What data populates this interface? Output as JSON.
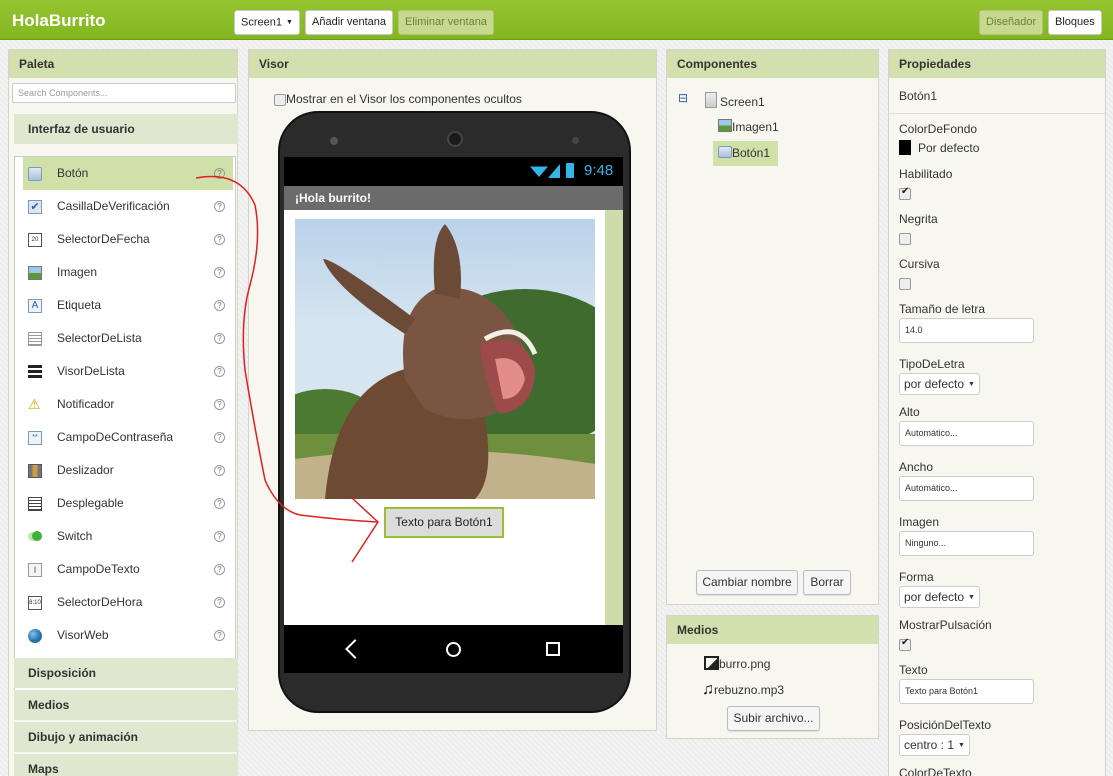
{
  "app": {
    "title": "HolaBurrito"
  },
  "toolbar": {
    "screen_select": "Screen1",
    "add_screen": "Añadir ventana",
    "remove_screen": "Eliminar ventana",
    "designer": "Diseñador",
    "blocks": "Bloques"
  },
  "palette": {
    "title": "Paleta",
    "search_placeholder": "Search Components...",
    "ui_section": "Interfaz de usuario",
    "items": [
      {
        "label": "Botón",
        "icon": "button-icon"
      },
      {
        "label": "CasillaDeVerificación",
        "icon": "checkbox-icon"
      },
      {
        "label": "SelectorDeFecha",
        "icon": "calendar-icon"
      },
      {
        "label": "Imagen",
        "icon": "image-icon"
      },
      {
        "label": "Etiqueta",
        "icon": "label-icon"
      },
      {
        "label": "SelectorDeLista",
        "icon": "listpicker-icon"
      },
      {
        "label": "VisorDeLista",
        "icon": "listview-icon"
      },
      {
        "label": "Notificador",
        "icon": "warning-icon"
      },
      {
        "label": "CampoDeContraseña",
        "icon": "password-icon"
      },
      {
        "label": "Deslizador",
        "icon": "slider-icon"
      },
      {
        "label": "Desplegable",
        "icon": "spinner-icon"
      },
      {
        "label": "Switch",
        "icon": "switch-icon"
      },
      {
        "label": "CampoDeTexto",
        "icon": "textbox-icon"
      },
      {
        "label": "SelectorDeHora",
        "icon": "clock-icon"
      },
      {
        "label": "VisorWeb",
        "icon": "globe-icon"
      }
    ],
    "help_glyph": "?",
    "sections": [
      "Disposición",
      "Medios",
      "Dibujo y animación",
      "Maps"
    ]
  },
  "viewer": {
    "title": "Visor",
    "show_hidden_label": "Mostrar en el Visor los componentes ocultos",
    "time": "9:48",
    "app_title": "¡Hola burrito!",
    "button_text": "Texto para Botón1"
  },
  "components": {
    "title": "Componentes",
    "tree": [
      {
        "label": "Screen1",
        "collapse": "⊟"
      },
      {
        "label": "Imagen1"
      },
      {
        "label": "Botón1"
      }
    ],
    "rename": "Cambiar nombre",
    "delete": "Borrar"
  },
  "media": {
    "title": "Medios",
    "files": [
      "burro.png",
      "rebuzno.mp3"
    ],
    "upload": "Subir archivo..."
  },
  "properties": {
    "title": "Propiedades",
    "component": "Botón1",
    "bg_label": "ColorDeFondo",
    "bg_value": "Por defecto",
    "enabled_label": "Habilitado",
    "bold_label": "Negrita",
    "italic_label": "Cursiva",
    "fontsize_label": "Tamaño de letra",
    "fontsize_value": "14.0",
    "font_label": "TipoDeLetra",
    "font_value": "por defecto",
    "height_label": "Alto",
    "height_value": "Automático...",
    "width_label": "Ancho",
    "width_value": "Automático...",
    "image_label": "Imagen",
    "image_value": "Ninguno...",
    "shape_label": "Forma",
    "shape_value": "por defecto",
    "feedback_label": "MostrarPulsación",
    "text_label": "Texto",
    "text_value": "Texto para Botón1",
    "align_label": "PosiciónDelTexto",
    "align_value": "centro : 1",
    "textcolor_label": "ColorDeTexto"
  },
  "colors": {
    "accent": "#8bc34a",
    "panel_header": "#d2e0b0",
    "selected": "#cfe0a8",
    "annotation": "#e02020"
  }
}
